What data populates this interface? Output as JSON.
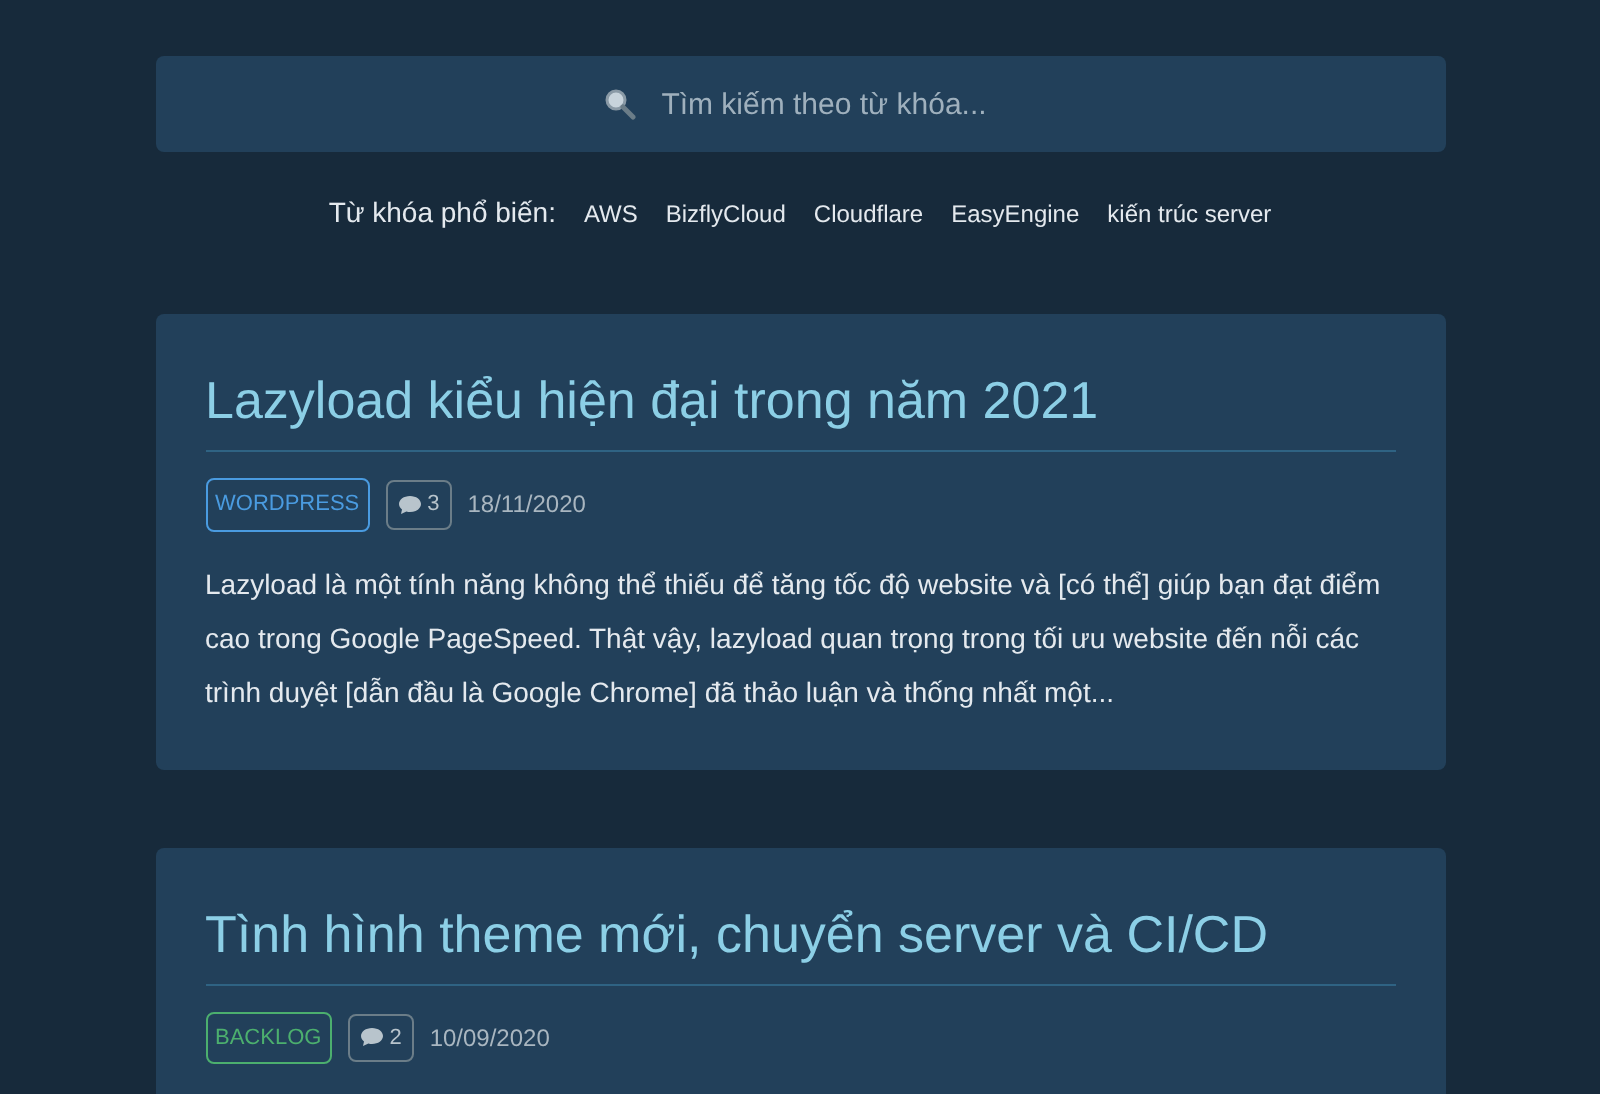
{
  "search": {
    "placeholder": "Tìm kiếm theo từ khóa..."
  },
  "popular": {
    "label": "Từ khóa phổ biến:",
    "keywords": [
      "AWS",
      "BizflyCloud",
      "Cloudflare",
      "EasyEngine",
      "kiến trúc server"
    ]
  },
  "posts": [
    {
      "title": "Lazyload kiểu hiện đại trong năm 2021",
      "tag": {
        "label": "WORDPRESS",
        "color": "#4a9be0"
      },
      "comments": "3",
      "date": "18/11/2020",
      "excerpt": "Lazyload là một tính năng không thể thiếu để tăng tốc độ website và [có thể] giúp bạn đạt điểm cao trong Google PageSpeed. Thật vậy, lazyload quan trọng trong tối ưu website đến nỗi các trình duyệt [dẫn đầu là Google Chrome] đã thảo luận và thống nhất một..."
    },
    {
      "title": "Tình hình theme mới, chuyển server và CI/CD",
      "tag": {
        "label": "BACKLOG",
        "color": "#4caf6e"
      },
      "comments": "2",
      "date": "10/09/2020"
    }
  ]
}
